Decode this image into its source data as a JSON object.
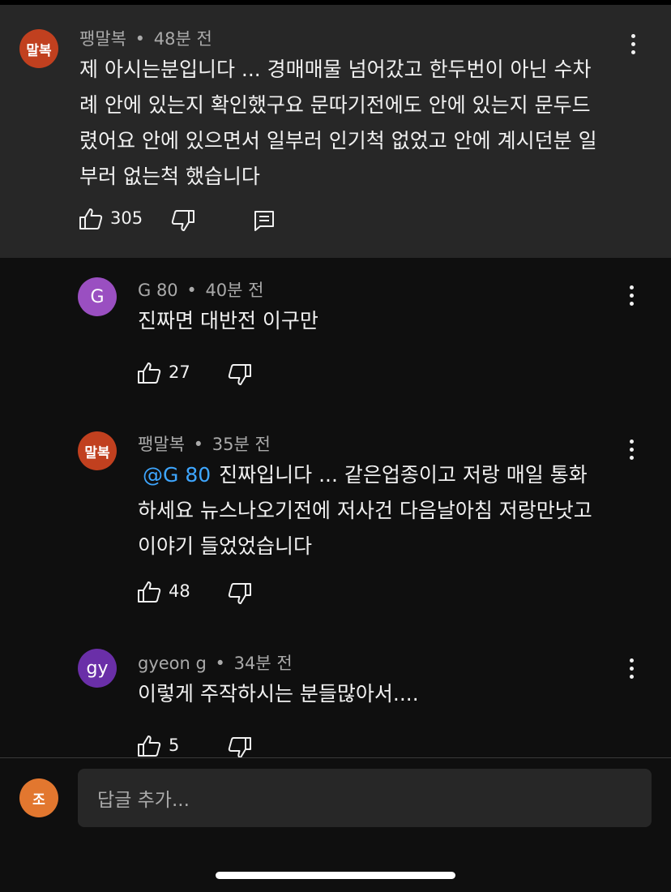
{
  "colors": {
    "background": "#0f0f0f",
    "pinned_background": "#272727",
    "mention": "#3ea6ff",
    "secondary_text": "#aaaaaa"
  },
  "comments": [
    {
      "avatar_text": "말복",
      "avatar_color": "#c1401f",
      "author": "팽말복",
      "separator": "•",
      "time": "48분 전",
      "lines": [
        "제 아시는분입니다 ... 경매매물 넘어갔고 한두번이 아닌 수차",
        "례 안에 있는지 확인했구요 문따기전에도 안에 있는지 문두드",
        "렸어요 안에 있으면서 일부러 인기척 없었고 안에 계시던분 일",
        "부러 없는척 했습니다"
      ],
      "likes": "305",
      "icons": [
        "thumbs-up-icon",
        "thumbs-down-icon",
        "reply-comment-icon"
      ]
    },
    {
      "avatar_text": "G",
      "avatar_color": "#9a4fc1",
      "author": "G 80",
      "separator": "•",
      "time": "40분 전",
      "lines": [
        "진짜면 대반전 이구만"
      ],
      "likes": "27"
    },
    {
      "avatar_text": "말복",
      "avatar_color": "#c1401f",
      "author": "팽말복",
      "separator": "•",
      "time": "35분 전",
      "mention": "@G 80",
      "lines": [
        "진짜입니다 ... 같은업종이고 저랑 매일 통화",
        "하세요 뉴스나오기전에 저사건 다음날아침 저랑만낫고",
        "이야기 들었었습니다"
      ],
      "likes": "48"
    },
    {
      "avatar_text": "gy",
      "avatar_color": "#6a2fa8",
      "author": "gyeon g",
      "separator": "•",
      "time": "34분 전",
      "lines": [
        "이렇게 주작하시는 분들많아서...."
      ],
      "likes": "5"
    }
  ],
  "reply_bar": {
    "avatar_text": "조",
    "avatar_color": "#e2772f",
    "placeholder": "답글 추가..."
  }
}
